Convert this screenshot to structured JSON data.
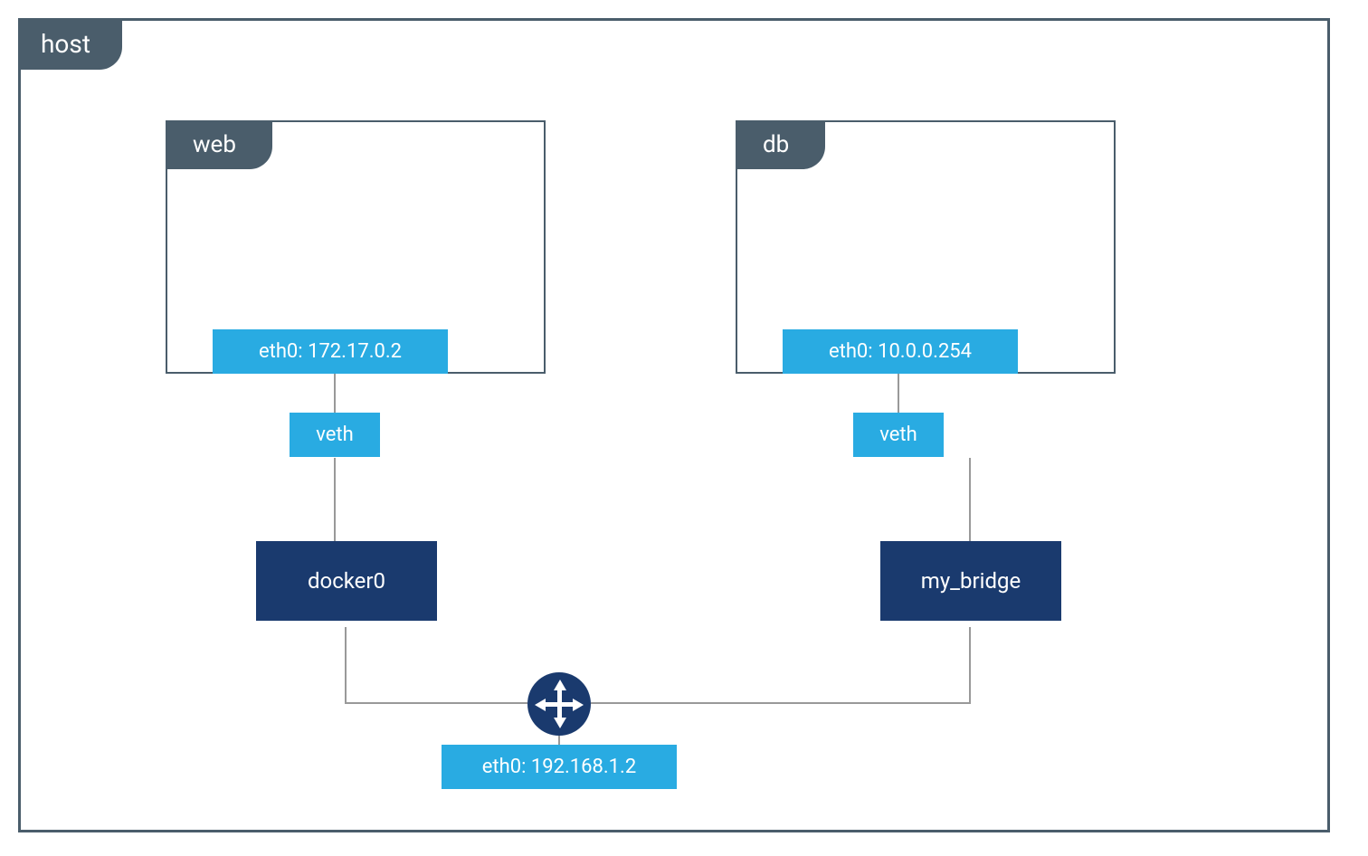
{
  "host": {
    "label": "host",
    "eth0": "eth0: 192.168.1.2"
  },
  "containers": {
    "web": {
      "label": "web",
      "eth0": "eth0: 172.17.0.2",
      "veth": "veth",
      "bridge": "docker0"
    },
    "db": {
      "label": "db",
      "eth0": "eth0: 10.0.0.254",
      "veth": "veth",
      "bridge": "my_bridge"
    }
  },
  "colors": {
    "tab_bg": "#4a5d6b",
    "eth_bg": "#29abe2",
    "bridge_bg": "#1a3a6e"
  }
}
